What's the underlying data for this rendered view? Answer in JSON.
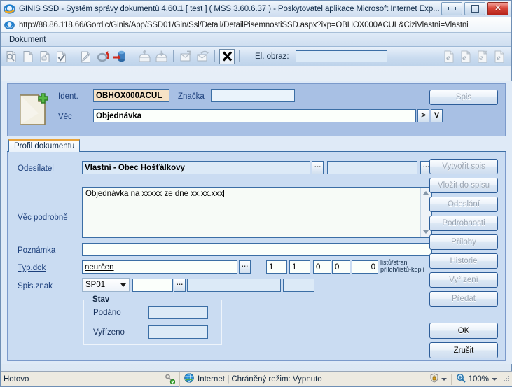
{
  "window": {
    "title": "GINIS SSD - Systém správy dokumentů 4.60.1 [ test ] ( MSS 3.60.6.37 ) - Poskytovatel aplikace Microsoft Internet Exp...",
    "minimize_label": "Minimalizovat",
    "maximize_label": "Maximalizovat",
    "close_label": "Zavřít"
  },
  "address": {
    "url": "http://88.86.118.66/Gordic/Ginis/App/SSD01/Gin/Ssl/Detail/DetailPisemnostiSSD.aspx?ixp=OBHOX000ACUL&CiziVlastni=Vlastni"
  },
  "menu": {
    "items": [
      "Dokument"
    ]
  },
  "toolbar": {
    "icons": [
      "search-document-icon",
      "new-document-icon",
      "new-document-lock-icon",
      "approve-document-icon",
      "edit-document-icon",
      "undo-icon",
      "import-database-icon",
      "outgoing-tray-icon",
      "incoming-tray-icon",
      "forward-envelope-icon",
      "reply-envelope-icon",
      "cancel-x-icon"
    ],
    "elobraz_label": "El. obraz:",
    "elobraz_value": "",
    "right_icons": [
      "e-document-icon",
      "e-document-add-icon",
      "e-document-edit-icon",
      "e-document-open-icon"
    ]
  },
  "header": {
    "doc_icon": "new-document-plus-icon",
    "ident_label": "Ident.",
    "ident_value": "OBHOX000ACUL",
    "znacka_label": "Značka",
    "znacka_value": "",
    "vec_label": "Věc",
    "vec_value": "Objednávka",
    "vec_arrow_button": ">",
    "vec_v_button": "V",
    "spis_button": "Spis"
  },
  "tabs": [
    {
      "label": "Profil dokumentu",
      "active": true
    }
  ],
  "form": {
    "odesilatel_label": "Odesílatel",
    "odesilatel_value": "Vlastní - Obec Hošťálkovy",
    "odesilatel_picker": "...",
    "odesilatel_second_value": "",
    "odesilatel_second_picker": "...",
    "vec_podrobne_label": "Věc podrobně",
    "vec_podrobne_value": "Objednávka na xxxxx ze dne xx.xx.xxx",
    "poznamka_label": "Poznámka",
    "poznamka_value": "",
    "typdok_label": "Typ.dok",
    "typdok_value": "neurčen",
    "typdok_picker": "...",
    "counts": [
      "1",
      "1",
      "0",
      "0",
      "0"
    ],
    "counts_caption_line1": "listů/stran",
    "counts_caption_line2": "příloh/listů-kopií",
    "spisznak_label": "Spis.znak",
    "spisznak_select": "SP01",
    "spisznak_field1": "",
    "spisznak_picker": "...",
    "spisznak_field2": "",
    "spisznak_field3": ""
  },
  "stav": {
    "title": "Stav",
    "podano_label": "Podáno",
    "podano_value": "",
    "vyrizeno_label": "Vyřízeno",
    "vyrizeno_value": ""
  },
  "side_buttons": [
    {
      "label": "Vytvořit spis",
      "enabled": false
    },
    {
      "label": "Vložit do spisu",
      "enabled": false
    },
    {
      "label": "Odeslání",
      "enabled": false
    },
    {
      "label": "Podrobnosti",
      "enabled": false
    },
    {
      "label": "Přílohy",
      "enabled": false
    },
    {
      "label": "Historie",
      "enabled": false
    },
    {
      "label": "Vyřízení",
      "enabled": false
    },
    {
      "label": "Předat",
      "enabled": false
    }
  ],
  "action_buttons": [
    {
      "label": "OK",
      "enabled": true
    },
    {
      "label": "Zrušit",
      "enabled": true
    }
  ],
  "statusbar": {
    "status_text": "Hotovo",
    "security_icon": "key-shield-icon",
    "zone_icon": "globe-icon",
    "zone_text": "Internet | Chráněný režim: Vypnuto",
    "protected_icon": "shield-icon",
    "zoom_icon": "zoom-icon",
    "zoom_level": "100%"
  },
  "colors": {
    "accent_blue": "#3b6ea5",
    "panel_blue": "#a8c0e4",
    "form_blue": "#cadcf2",
    "ident_bg": "#f6e2c6",
    "tab_orange": "#e9a33a",
    "label_blue": "#1c3f7c"
  }
}
